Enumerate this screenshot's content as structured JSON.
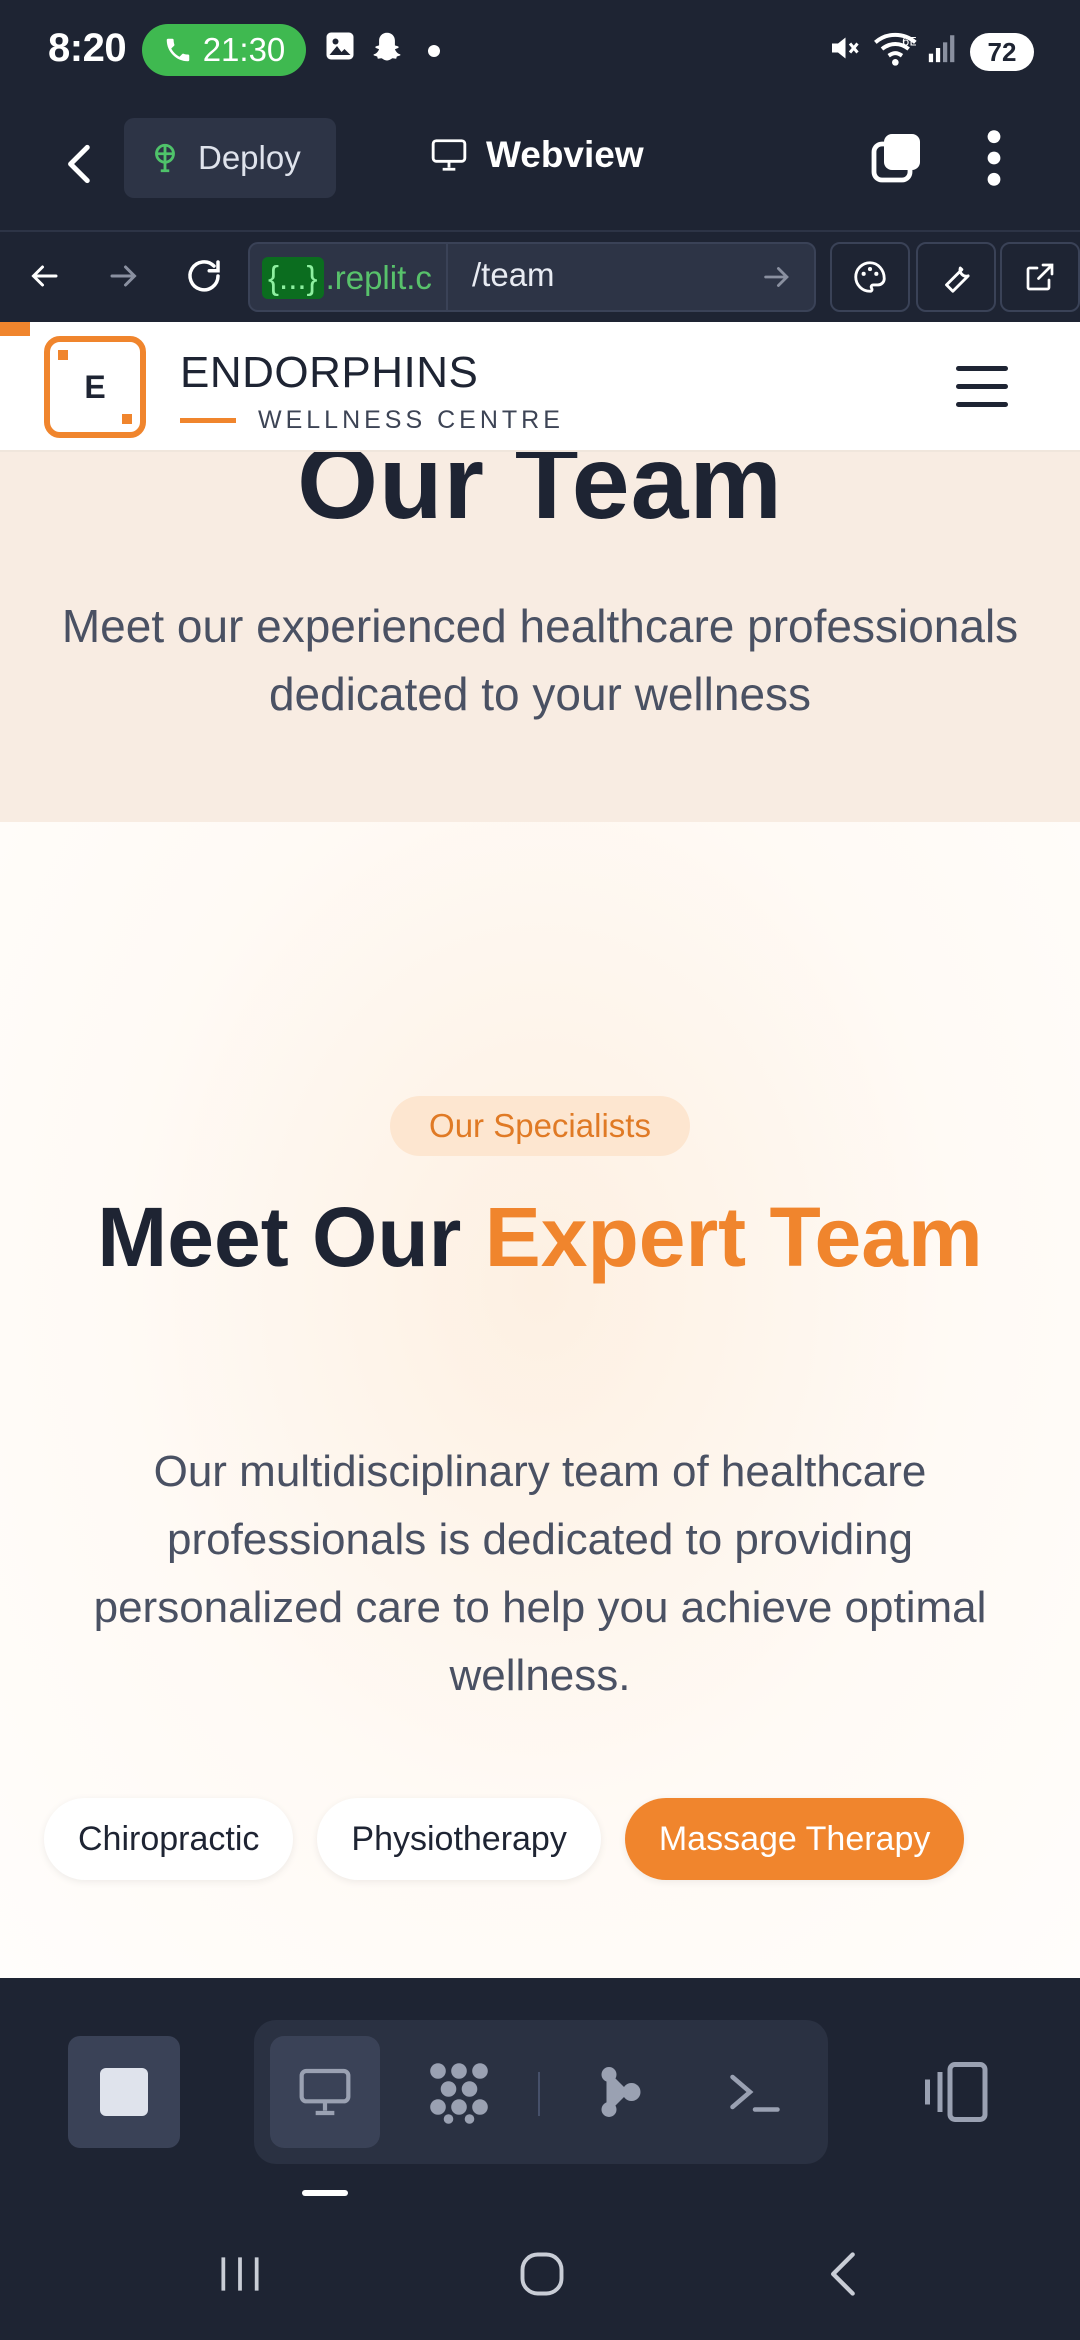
{
  "status_bar": {
    "time": "8:20",
    "call_timer": "21:30",
    "battery": "72",
    "wifi_label": "6E"
  },
  "replit_top": {
    "deploy_label": "Deploy",
    "webview_label": "Webview"
  },
  "url_bar": {
    "host_brace": "{...}",
    "host": ".replit.c",
    "path": "/team"
  },
  "site": {
    "brand_initial": "E",
    "brand_name": "ENDORPHINS",
    "brand_tagline": "WELLNESS CENTRE",
    "hero_title": "Our Team",
    "hero_subtitle": "Meet our experienced healthcare professionals dedicated to your wellness",
    "section_badge": "Our Specialists",
    "section_title_plain": "Meet Our ",
    "section_title_accent": "Expert Team",
    "section_body": "Our multidisciplinary team of healthcare professionals is dedicated to providing personalized care to help you achieve optimal wellness.",
    "filters": [
      {
        "label": "Chiropractic",
        "active": false
      },
      {
        "label": "Physiotherapy",
        "active": false
      },
      {
        "label": "Massage Therapy",
        "active": true
      }
    ]
  },
  "colors": {
    "accent": "#f0852d",
    "dark": "#1e2433",
    "hero_bg": "#f8ece2",
    "call_green": "#3fb950"
  },
  "icons": {
    "top": [
      "back-arrow-icon",
      "deploy-icon",
      "monitor-icon",
      "tabs-icon",
      "more-vertical-icon"
    ],
    "url": [
      "nav-back-icon",
      "nav-forward-icon",
      "reload-icon",
      "go-arrow-icon",
      "palette-icon",
      "wrench-icon",
      "external-link-icon"
    ],
    "bottom": [
      "stop-icon",
      "monitor-icon",
      "apps-grid-icon",
      "agent-icon",
      "terminal-icon",
      "devices-icon"
    ],
    "nav": [
      "recents-icon",
      "home-icon",
      "back-icon"
    ]
  }
}
